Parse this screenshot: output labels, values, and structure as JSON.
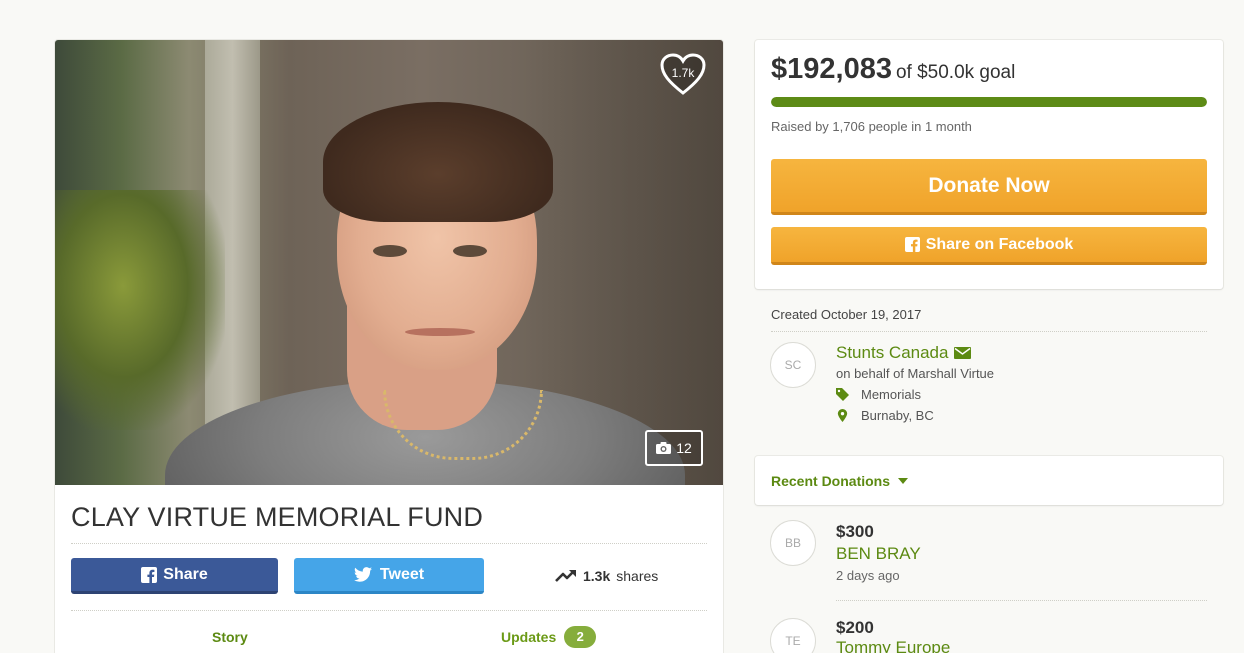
{
  "campaign": {
    "title": "CLAY VIRTUE MEMORIAL FUND",
    "hearts": "1.7k",
    "photo_count": "12"
  },
  "social": {
    "share_label": "Share",
    "tweet_label": "Tweet",
    "shares_count": "1.3k",
    "shares_label": "shares"
  },
  "tabs": {
    "story_label": "Story",
    "updates_label": "Updates",
    "updates_count": "2"
  },
  "donate": {
    "raised": "$192,083",
    "goal_text": "of $50.0k goal",
    "progress_fraction": 1.0,
    "raised_by": "Raised by 1,706 people in 1 month",
    "donate_label": "Donate Now",
    "facebook_label": "Share on Facebook"
  },
  "organizer": {
    "created": "Created October 19, 2017",
    "initials": "SC",
    "name": "Stunts Canada",
    "behalf": "on behalf of Marshall Virtue",
    "category": "Memorials",
    "location": "Burnaby, BC"
  },
  "recent": {
    "header": "Recent Donations",
    "donations": [
      {
        "initials": "BB",
        "amount": "$300",
        "name": "BEN BRAY",
        "time": "2 days ago"
      },
      {
        "initials": "TE",
        "amount": "$200",
        "name": "Tommy Europe",
        "time": ""
      }
    ]
  },
  "colors": {
    "accent_green": "#5c8a12",
    "donate_orange": "#f2a830",
    "facebook_blue": "#3b5998",
    "twitter_blue": "#45a5e8"
  },
  "icons": {
    "heart": "heart-icon",
    "camera": "camera-icon",
    "facebook": "facebook-icon",
    "twitter": "twitter-icon",
    "trend": "trending-up-icon",
    "envelope": "envelope-icon",
    "tag": "tag-icon",
    "location": "map-pin-icon",
    "caret": "caret-down-icon"
  }
}
